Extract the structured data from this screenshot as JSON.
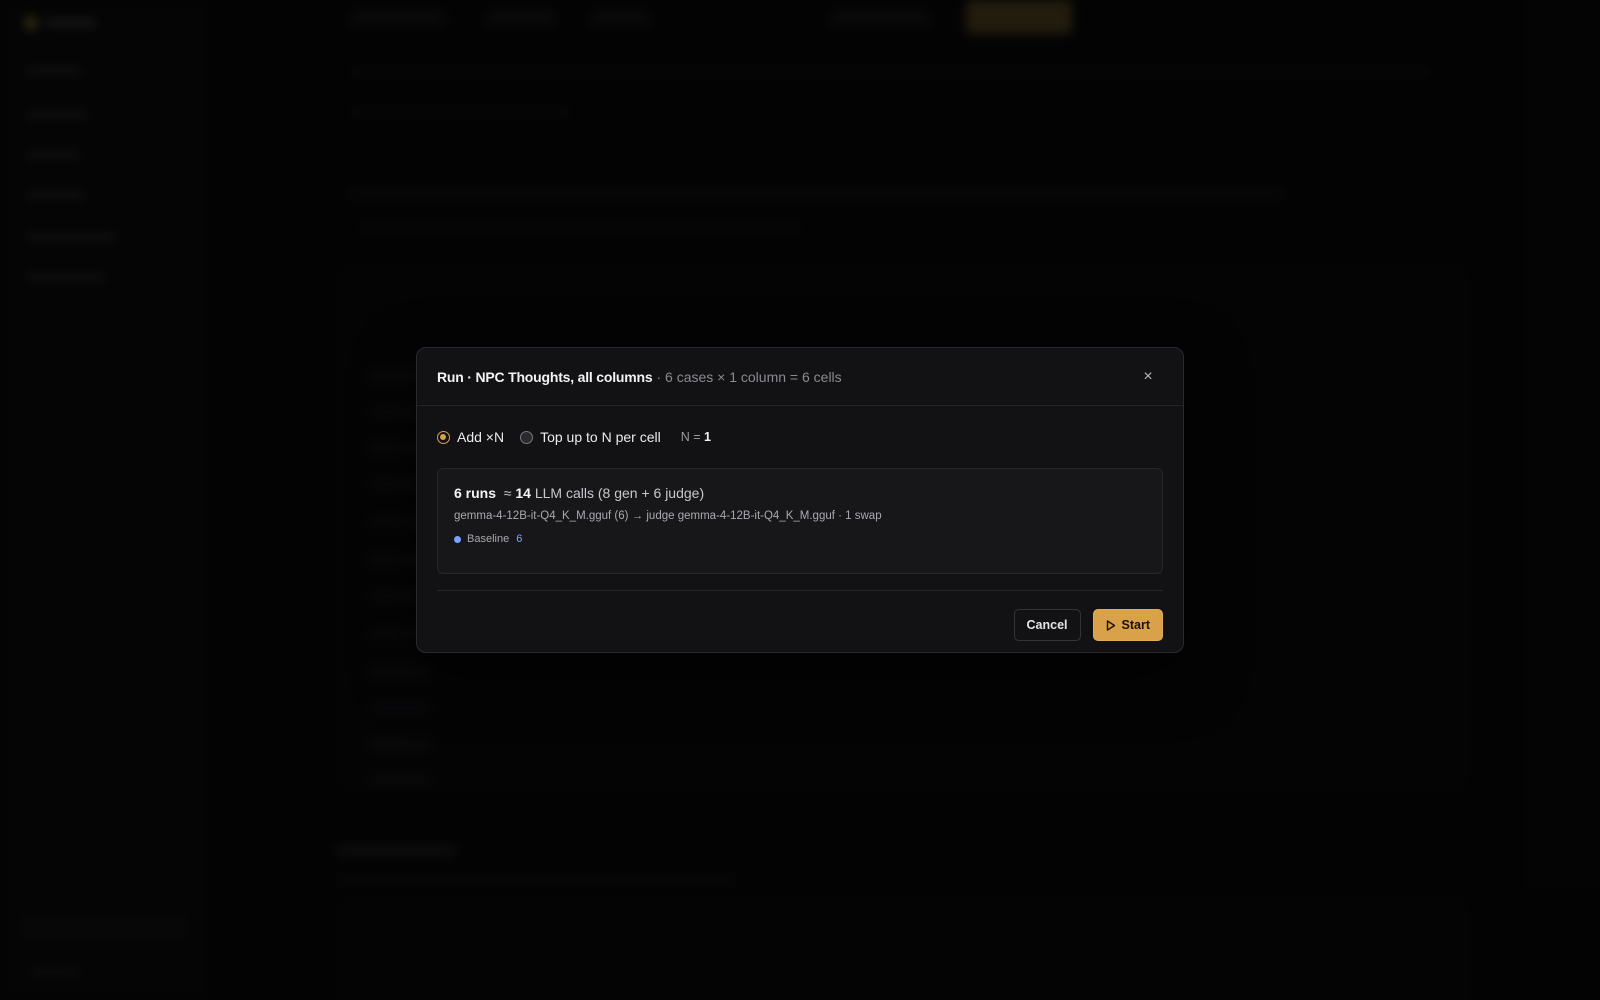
{
  "modal": {
    "title": "Run · NPC Thoughts, all columns",
    "subtitle": "· 6 cases × 1 column = 6 cells",
    "close_glyph": "×",
    "modes": [
      {
        "label": "Add ×N",
        "selected": true
      },
      {
        "label": "Top up to N per cell",
        "selected": false
      }
    ],
    "n_label": "N =",
    "n_value": "1",
    "summary": {
      "runs": "6 runs",
      "approx": "≈",
      "calls_count": "14",
      "calls_text": "LLM calls (8 gen + 6 judge)",
      "model_line": "gemma-4-12B-it-Q4_K_M.gguf (6) → judge gemma-4-12B-it-Q4_K_M.gguf · 1 swap",
      "legend": {
        "name": "Baseline",
        "count": "6",
        "color": "#7aa2ff"
      }
    },
    "cancel_label": "Cancel",
    "start_label": "Start"
  },
  "colors": {
    "accent": "#d9a24a",
    "series_blue": "#7aa2ff",
    "modal_bg": "#121215"
  },
  "icons": [
    "close-icon",
    "play-icon"
  ]
}
